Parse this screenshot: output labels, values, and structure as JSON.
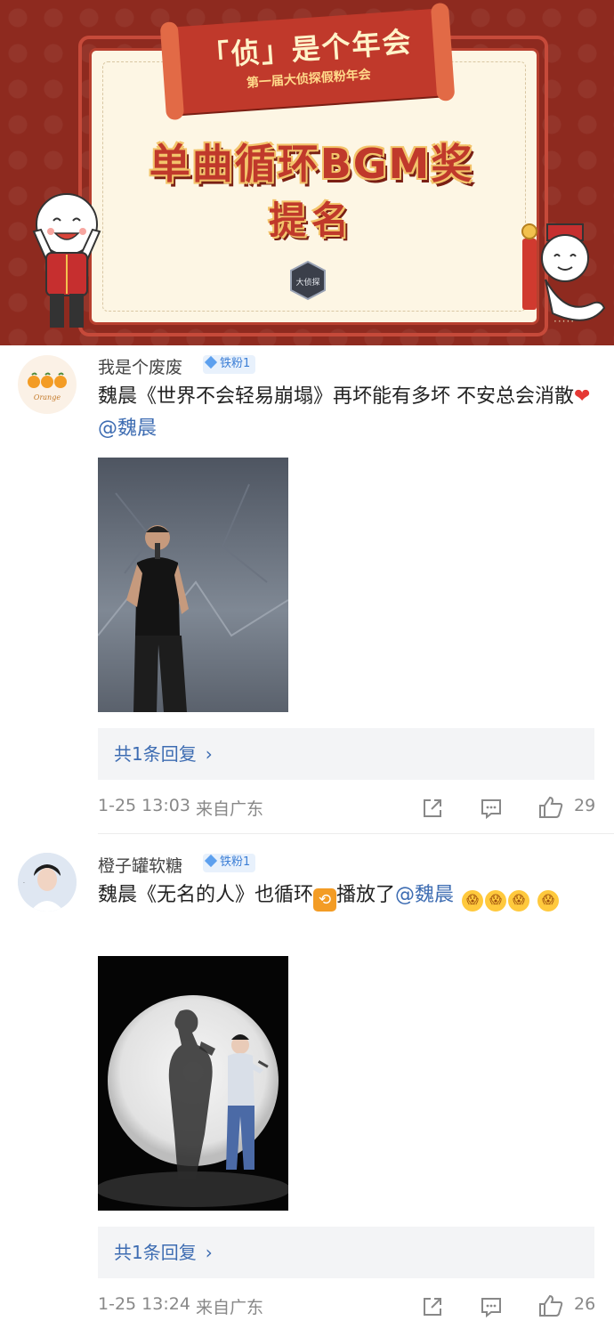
{
  "banner": {
    "ribbon_title": "「侦」是个年会",
    "ribbon_subtitle": "第一届大侦探假粉年会",
    "award_title": "单曲循环BGM奖",
    "award_subtitle": "提名",
    "show_logo_text": "大侦探"
  },
  "comments": [
    {
      "username": "我是个废废",
      "badge": "铁粉1",
      "avatar_text": "Orange",
      "text_before": "魏晨《世界不会轻易崩塌》再坏能有多坏 不安总会消散",
      "emoji_heart": "❤",
      "mention": "@魏晨",
      "reply_label": "共1条回复",
      "reply_chevron": "›",
      "time": "1-25 13:03",
      "location": "来自广东",
      "likes": "29"
    },
    {
      "username": "橙子罐软糖",
      "badge": "铁粉1",
      "text_before": "魏晨《无名的人》也循环",
      "emoji_loop": "⟲",
      "text_after": "播放了",
      "mention": "@魏晨",
      "emoji_faces": [
        "😱",
        "😱",
        "😱",
        "😱"
      ],
      "reply_label": "共1条回复",
      "reply_chevron": "›",
      "time": "1-25 13:24",
      "location": "来自广东",
      "likes": "26"
    }
  ]
}
